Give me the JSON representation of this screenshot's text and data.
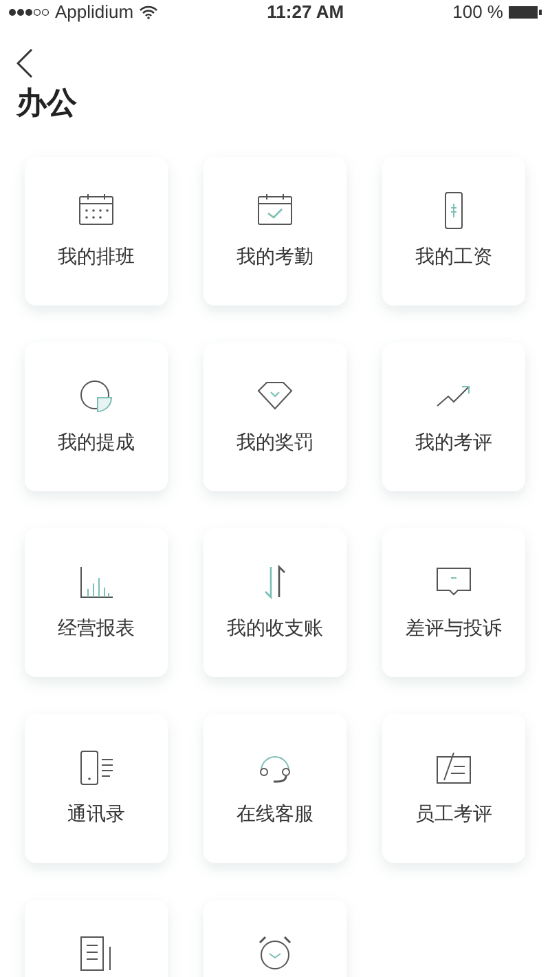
{
  "status_bar": {
    "carrier": "Applidium",
    "time": "11:27 AM",
    "battery": "100 %"
  },
  "title": "办公",
  "items": [
    {
      "kind": "tile",
      "label": "我的排班"
    },
    {
      "kind": "tile",
      "label": "我的考勤"
    },
    {
      "kind": "tile",
      "label": "我的工资"
    },
    {
      "kind": "tile",
      "label": "我的提成"
    },
    {
      "kind": "tile",
      "label": "我的奖罚"
    },
    {
      "kind": "tile",
      "label": "我的考评"
    },
    {
      "kind": "tile",
      "label": "经营报表"
    },
    {
      "kind": "tile",
      "label": "我的收支账"
    },
    {
      "kind": "tile",
      "label": "差评与投诉"
    },
    {
      "kind": "tile",
      "label": "通讯录"
    },
    {
      "kind": "tile",
      "label": "在线客服"
    },
    {
      "kind": "tile",
      "label": "员工考评"
    },
    {
      "kind": "tile"
    },
    {
      "kind": "tile"
    }
  ]
}
